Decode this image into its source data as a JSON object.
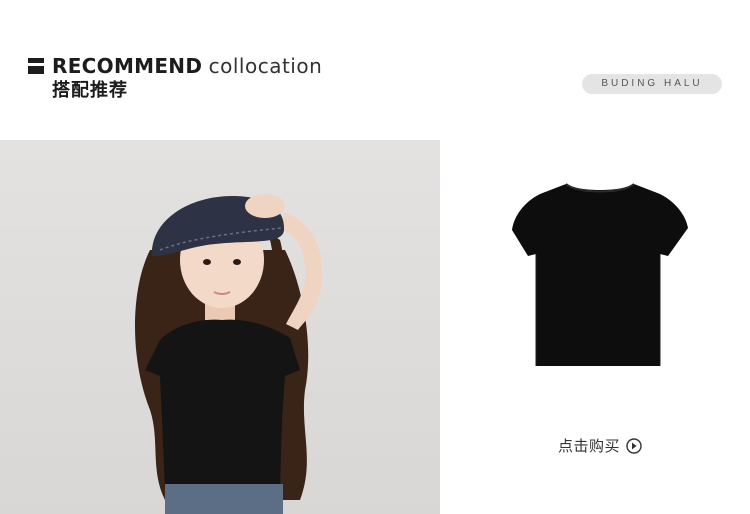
{
  "header": {
    "title_en_strong": "RECOMMEND",
    "title_en_light": "collocation",
    "title_cn": "搭配推荐",
    "brand": "BUDING HALU"
  },
  "product": {
    "buy_label": "点击购买",
    "buy_icon": "arrow-circle-right-icon"
  },
  "colors": {
    "accent": "#1c1c1c",
    "pill_bg": "#e4e4e4",
    "photo_bg": "#dfdddb"
  }
}
